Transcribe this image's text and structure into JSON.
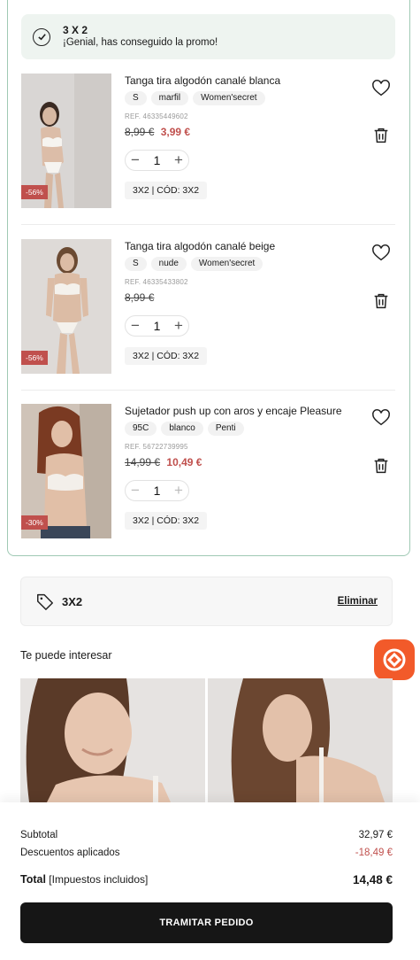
{
  "promo": {
    "title": "3 X 2",
    "subtitle": "¡Genial, has conseguido la promo!"
  },
  "items": [
    {
      "name": "Tanga tira algodón canalé blanca",
      "size": "S",
      "color": "marfil",
      "brand": "Women'secret",
      "ref": "REF. 46335449602",
      "old_price": "8,99 €",
      "new_price": "3,99 €",
      "qty": "1",
      "discount": "-56%",
      "promo_code": "3X2 | CÓD: 3X2"
    },
    {
      "name": "Tanga tira algodón canalé beige",
      "size": "S",
      "color": "nude",
      "brand": "Women'secret",
      "ref": "REF. 46335433802",
      "old_price": "8,99 €",
      "new_price": "",
      "qty": "1",
      "discount": "-56%",
      "promo_code": "3X2 | CÓD: 3X2"
    },
    {
      "name": "Sujetador push up con aros y encaje Pleasure",
      "size": "95C",
      "color": "blanco",
      "brand": "Penti",
      "ref": "REF. 56722739995",
      "old_price": "14,99 €",
      "new_price": "10,49 €",
      "qty": "1",
      "discount": "-30%",
      "promo_code": "3X2 | CÓD: 3X2"
    }
  ],
  "coupon": {
    "code": "3X2",
    "remove_label": "Eliminar"
  },
  "recommendations": {
    "title": "Te puede interesar"
  },
  "summary": {
    "subtotal_label": "Subtotal",
    "subtotal_value": "32,97 €",
    "discount_label": "Descuentos aplicados",
    "discount_value": "-18,49 €",
    "total_label": "Total",
    "total_note": "[Impuestos incluidos]",
    "total_value": "14,48 €"
  },
  "checkout_label": "TRAMITAR PEDIDO",
  "colors": {
    "accent": "#c0504d",
    "promo_border": "#9fc9b4",
    "fab": "#f25a2a",
    "button": "#161616"
  }
}
